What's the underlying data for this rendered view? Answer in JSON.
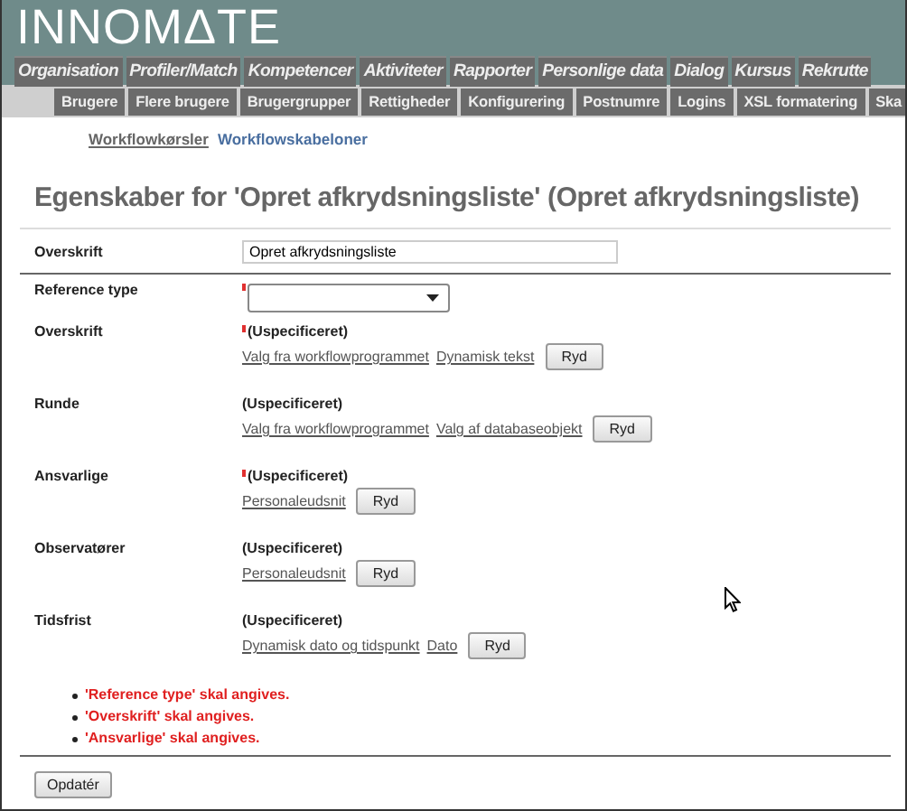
{
  "logo": "INNOMΔTE",
  "main_tabs": [
    "Organisation",
    "Profiler/Match",
    "Kompetencer",
    "Aktiviteter",
    "Rapporter",
    "Personlige data",
    "Dialog",
    "Kursus",
    "Rekrutte"
  ],
  "sub_tabs": [
    "Brugere",
    "Flere brugere",
    "Brugergrupper",
    "Rettigheder",
    "Konfigurering",
    "Postnumre",
    "Logins",
    "XSL formatering",
    "Ska"
  ],
  "page_links": [
    {
      "label": "Workflowkørsler",
      "selected": false
    },
    {
      "label": "Workflowskabeloner",
      "selected": true
    }
  ],
  "title": "Egenskaber for 'Opret afkrydsningsliste' (Opret afkrydsningsliste)",
  "fields": [
    {
      "kind": "text",
      "label": "Overskrift",
      "value": "Opret afkrydsningsliste"
    },
    {
      "kind": "select",
      "label": "Reference type",
      "required": true
    },
    {
      "kind": "value",
      "label": "Overskrift",
      "required": true,
      "value": "(Uspecificeret)",
      "links": [
        "Valg fra workflowprogrammet",
        "Dynamisk tekst"
      ],
      "button": "Ryd"
    },
    {
      "kind": "value",
      "label": "Runde",
      "required": false,
      "value": "(Uspecificeret)",
      "links": [
        "Valg fra workflowprogrammet",
        "Valg af databaseobjekt"
      ],
      "button": "Ryd"
    },
    {
      "kind": "value",
      "label": "Ansvarlige",
      "required": true,
      "value": "(Uspecificeret)",
      "links": [
        "Personaleudsnit"
      ],
      "button": "Ryd"
    },
    {
      "kind": "value",
      "label": "Observatører",
      "required": false,
      "value": "(Uspecificeret)",
      "links": [
        "Personaleudsnit"
      ],
      "button": "Ryd"
    },
    {
      "kind": "value",
      "label": "Tidsfrist",
      "required": false,
      "value": "(Uspecificeret)",
      "links": [
        "Dynamisk dato og tidspunkt",
        "Dato"
      ],
      "button": "Ryd"
    }
  ],
  "errors": [
    "'Reference type' skal angives.",
    "'Overskrift' skal angives.",
    "'Ansvarlige' skal angives."
  ],
  "submit_button": "Opdatér"
}
